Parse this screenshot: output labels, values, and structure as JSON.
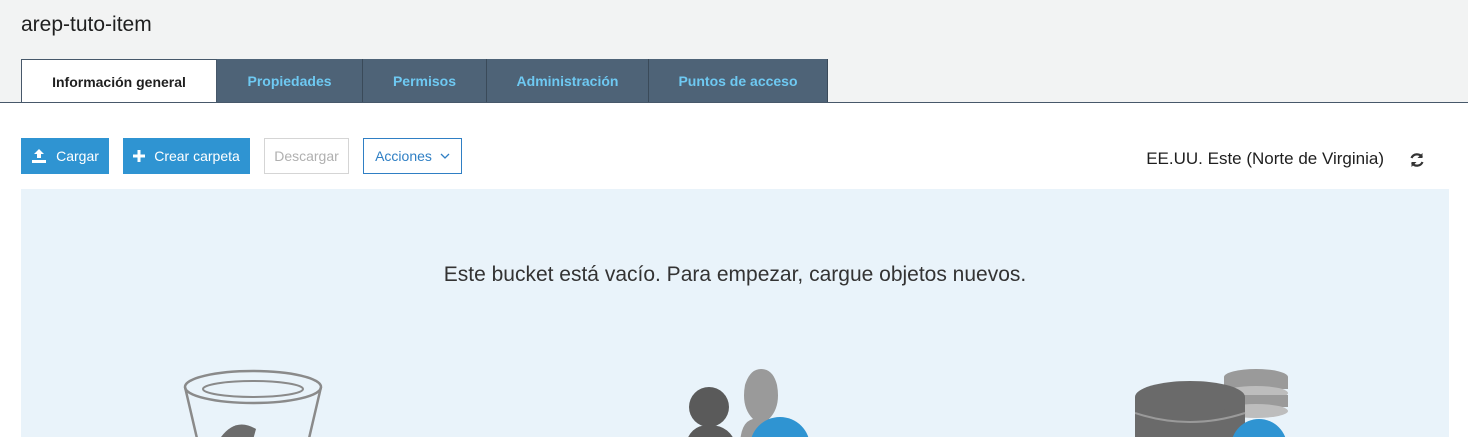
{
  "bucket": {
    "name": "arep-tuto-item"
  },
  "tabs": [
    {
      "label": "Información general",
      "active": true
    },
    {
      "label": "Propiedades",
      "active": false
    },
    {
      "label": "Permisos",
      "active": false
    },
    {
      "label": "Administración",
      "active": false
    },
    {
      "label": "Puntos de acceso",
      "active": false
    }
  ],
  "toolbar": {
    "upload_label": "Cargar",
    "upload_icon": "upload-icon",
    "create_folder_label": "Crear carpeta",
    "create_folder_icon": "plus-icon",
    "download_label": "Descargar",
    "actions_label": "Acciones",
    "actions_icon": "chevron-down-icon"
  },
  "region": {
    "label": "EE.UU. Este (Norte de Virginia)",
    "refresh_icon": "refresh-icon"
  },
  "empty_state": {
    "message": "Este bucket está vacío. Para empezar, cargue objetos nuevos.",
    "illustrations": [
      "bucket-icon",
      "users-icon",
      "database-icon"
    ]
  },
  "colors": {
    "accent": "#2f94d2",
    "tab_bg": "#4e6377",
    "tab_text": "#6ec9f2",
    "panel_bg": "#e9f3fa"
  }
}
